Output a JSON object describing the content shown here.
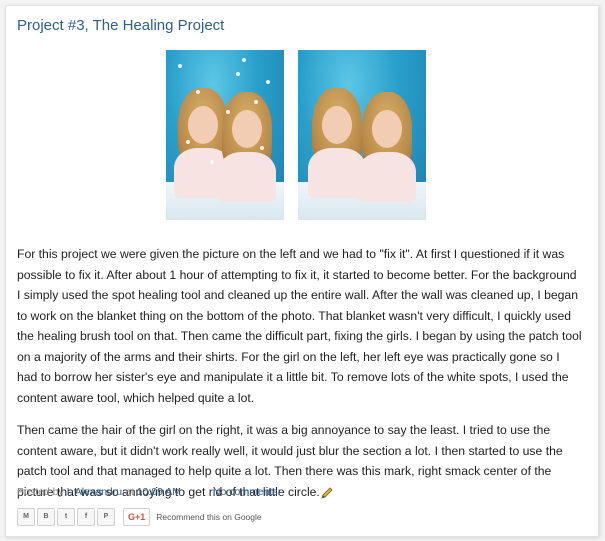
{
  "post": {
    "title": "Project #3, The Healing Project",
    "paragraphs": [
      "For this project we were given the picture on the left and we had to \"fix it\". At first I questioned if it was possible to fix it. After about 1 hour of attempting to fix it, it started to become better. For the background I simply used the spot healing tool and cleaned up the entire wall. After the wall was cleaned up, I began to work on the blanket thing on the bottom of the photo. That blanket wasn't very difficult, I quickly used the healing brush tool on that. Then came the difficult part, fixing the girls. I began by using the patch tool on a majority of the arms and their shirts. For the girl on the left, her left eye was practically gone so I had to borrow her sister's eye and manipulate it a little bit. To remove lots of the white spots, I used the content aware tool, which helped quite a lot.",
      "Then came the hair of the girl on the right, it was a big annoyance to say the least. I tried to use the content aware, but it didn't work really well, it would just blur the section a lot. I then started to use the patch tool and that managed to help quite a lot. Then there was this mark, right smack center of the picture that was so annoying to get rid of that little circle."
    ]
  },
  "meta": {
    "posted_by": "Posted by",
    "author": "I. Alexandru",
    "at": "at",
    "time": "10:09 AM",
    "comments": "No comments:"
  },
  "share": {
    "buttons": [
      "M",
      "B",
      "t",
      "f",
      "P"
    ],
    "gplus": "G+1",
    "recommend": "Recommend this on Google"
  },
  "icons": {
    "edit": "pencil-icon"
  }
}
